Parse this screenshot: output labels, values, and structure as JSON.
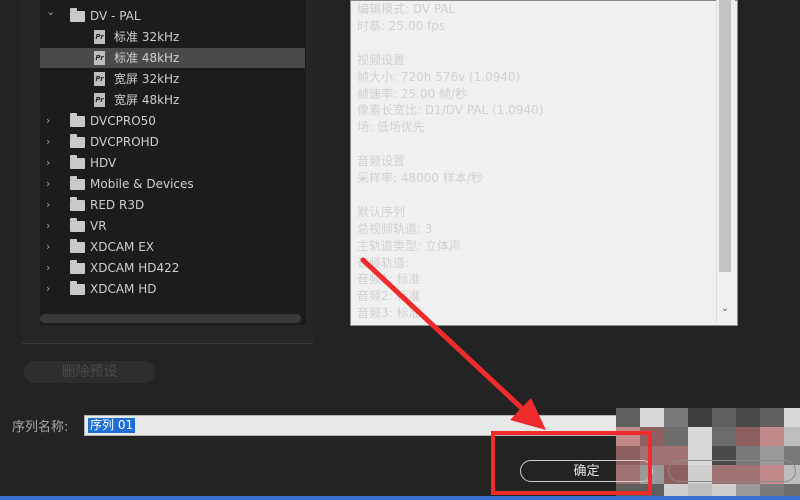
{
  "tree": {
    "items": [
      {
        "type": "folder",
        "label": "DV - PAL",
        "expanded": true
      },
      {
        "type": "file",
        "label": "标准 32kHz"
      },
      {
        "type": "file",
        "label": "标准 48kHz",
        "selected": true
      },
      {
        "type": "file",
        "label": "宽屏 32kHz"
      },
      {
        "type": "file",
        "label": "宽屏 48kHz"
      },
      {
        "type": "folder",
        "label": "DVCPRO50"
      },
      {
        "type": "folder",
        "label": "DVCPROHD"
      },
      {
        "type": "folder",
        "label": "HDV"
      },
      {
        "type": "folder",
        "label": "Mobile & Devices"
      },
      {
        "type": "folder",
        "label": "RED R3D"
      },
      {
        "type": "folder",
        "label": "VR"
      },
      {
        "type": "folder",
        "label": "XDCAM EX"
      },
      {
        "type": "folder",
        "label": "XDCAM HD422"
      },
      {
        "type": "folder",
        "label": "XDCAM HD"
      }
    ],
    "file_icon_text": "Pr"
  },
  "description": {
    "lines": [
      "编辑模式: DV PAL",
      "时基: 25.00 fps",
      "",
      "视频设置",
      " 帧大小: 720h 576v (1.0940)",
      " 帧速率: 25.00 帧/秒",
      " 像素长宽比: D1/DV PAL (1.0940)",
      " 场: 低场优先",
      "",
      "音频设置",
      " 采样率: 48000 样本/秒",
      "",
      "默认序列",
      " 总视频轨道: 3",
      " 主轨道类型: 立体声",
      " 音频轨道:",
      " 音频1: 标准",
      " 音频2: 标准",
      " 音频3: 标准"
    ]
  },
  "buttons": {
    "delete_preset": "删除预设",
    "ok": "确定"
  },
  "sequence_name": {
    "label": "序列名称:",
    "value": "序列 01"
  },
  "colors": {
    "annotation": "#ef2b2b",
    "selection": "#1d6fd6"
  }
}
